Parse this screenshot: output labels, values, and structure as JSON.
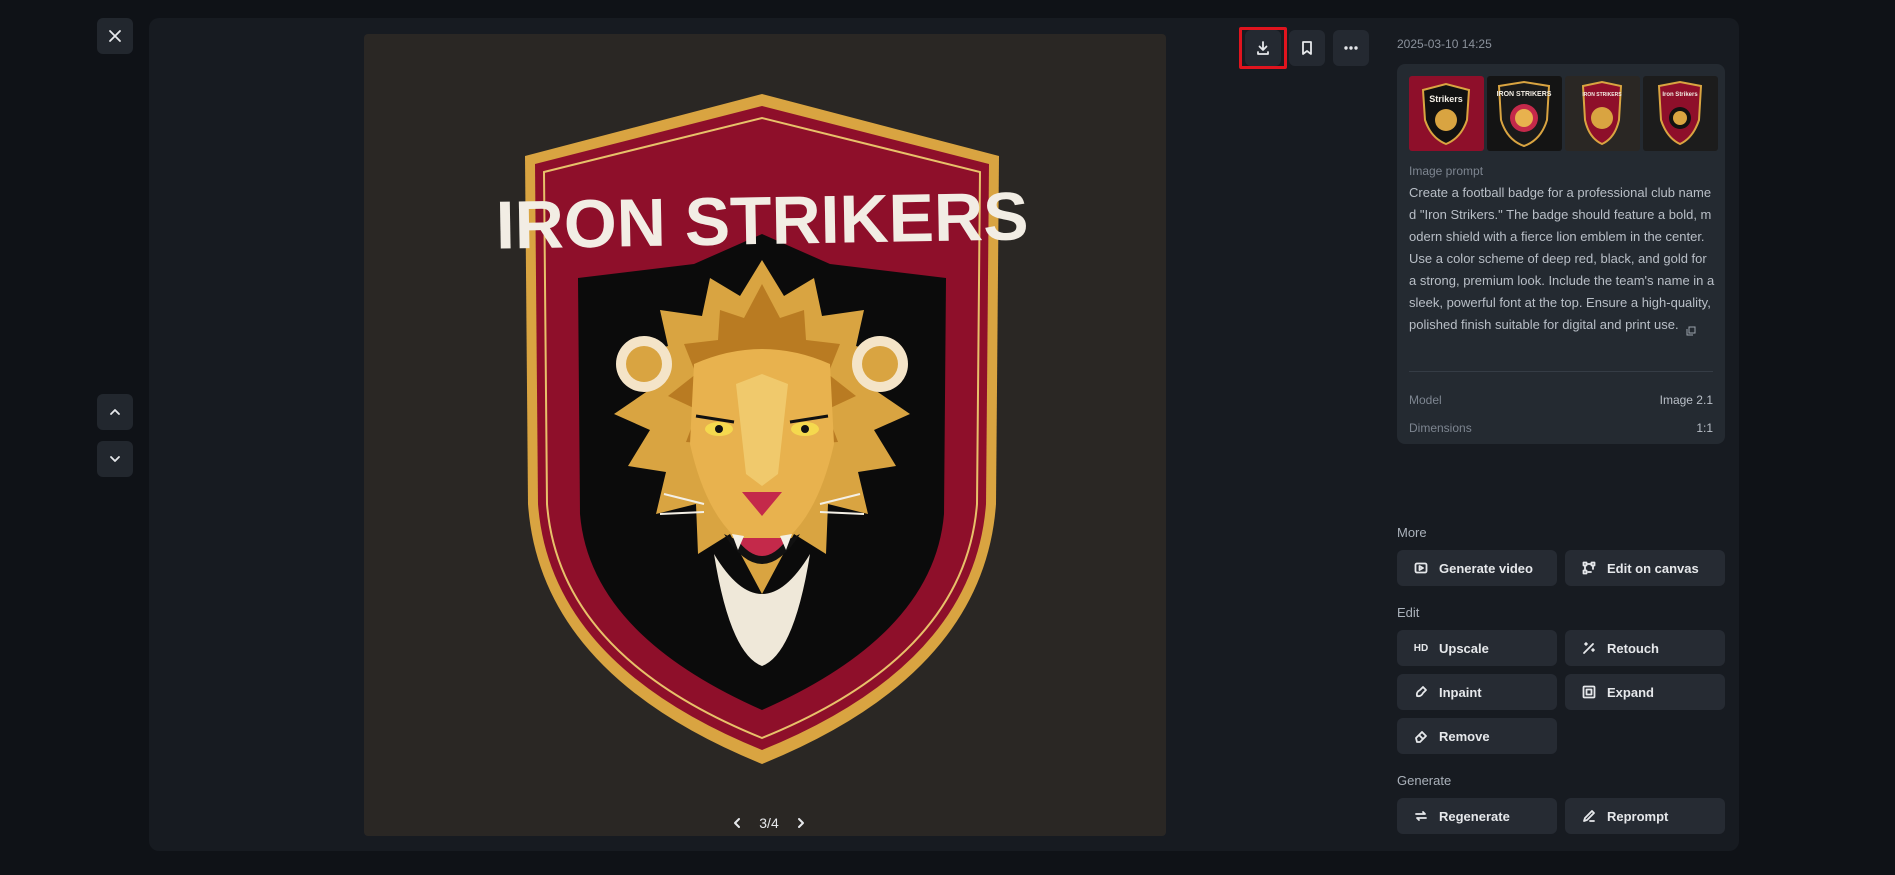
{
  "viewer": {
    "badge_title": "IRON STRIKERS",
    "pager_text": "3/4"
  },
  "sidebar": {
    "timestamp": "2025-03-10 14:25",
    "thumbnails": [
      {
        "label": "Strikers"
      },
      {
        "label": "IRON STRIKERS"
      },
      {
        "label": "IRON STRIKERS"
      },
      {
        "label": "Iron Strikers"
      }
    ],
    "prompt_label": "Image prompt",
    "prompt_text": "Create a football badge for a professional club named \"Iron Strikers.\" The badge should feature a bold, modern shield with a fierce lion emblem in the center. Use a color scheme of deep red, black, and gold for a strong, premium look. Include the team's name in a sleek, powerful font at the top. Ensure a high-quality, polished finish suitable for digital and print use.",
    "model_label": "Model",
    "model_value": "Image 2.1",
    "dimensions_label": "Dimensions",
    "dimensions_value": "1:1"
  },
  "more": {
    "label": "More",
    "generate_video": "Generate video",
    "edit_on_canvas": "Edit on canvas"
  },
  "edit": {
    "label": "Edit",
    "upscale": "Upscale",
    "upscale_icon_text": "HD",
    "retouch": "Retouch",
    "inpaint": "Inpaint",
    "expand": "Expand",
    "remove": "Remove"
  },
  "generate": {
    "label": "Generate",
    "regenerate": "Regenerate",
    "reprompt": "Reprompt"
  },
  "colors": {
    "accent_highlight": "#e0141e",
    "badge_red": "#8e0f2a",
    "badge_gold": "#d9a441",
    "badge_black": "#0b0b0b"
  },
  "icons": [
    "close-icon",
    "chevron-up-icon",
    "chevron-down-icon",
    "download-icon",
    "bookmark-icon",
    "more-horizontal-icon",
    "chevron-left-icon",
    "chevron-right-icon",
    "copy-icon",
    "video-icon",
    "canvas-icon",
    "hd-icon",
    "retouch-icon",
    "inpaint-icon",
    "expand-icon",
    "eraser-icon",
    "regenerate-icon",
    "pencil-icon"
  ]
}
